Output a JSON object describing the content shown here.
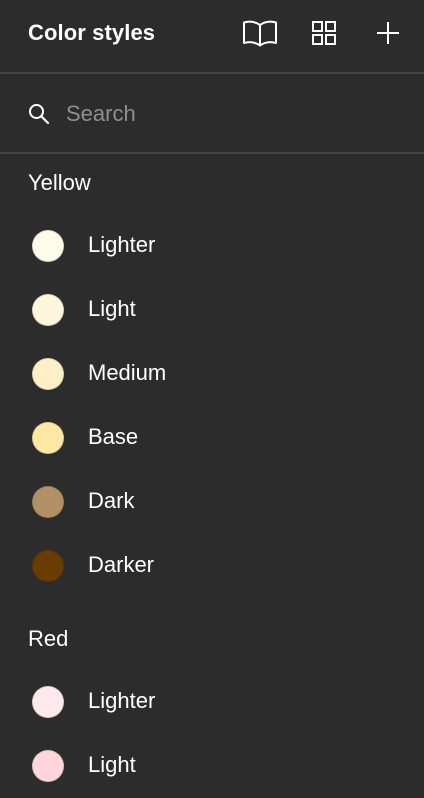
{
  "header": {
    "title": "Color styles",
    "icons": [
      "book-open-icon",
      "grid-icon",
      "plus-icon"
    ]
  },
  "search": {
    "placeholder": "Search",
    "value": ""
  },
  "groups": [
    {
      "name": "Yellow",
      "styles": [
        {
          "label": "Lighter",
          "color": "#fffbea"
        },
        {
          "label": "Light",
          "color": "#fff6dc"
        },
        {
          "label": "Medium",
          "color": "#ffefc6"
        },
        {
          "label": "Base",
          "color": "#ffe8a3"
        },
        {
          "label": "Dark",
          "color": "#b09064"
        },
        {
          "label": "Darker",
          "color": "#6a3c03"
        }
      ]
    },
    {
      "name": "Red",
      "styles": [
        {
          "label": "Lighter",
          "color": "#ffe9ec"
        },
        {
          "label": "Light",
          "color": "#ffd6dd"
        }
      ]
    }
  ]
}
